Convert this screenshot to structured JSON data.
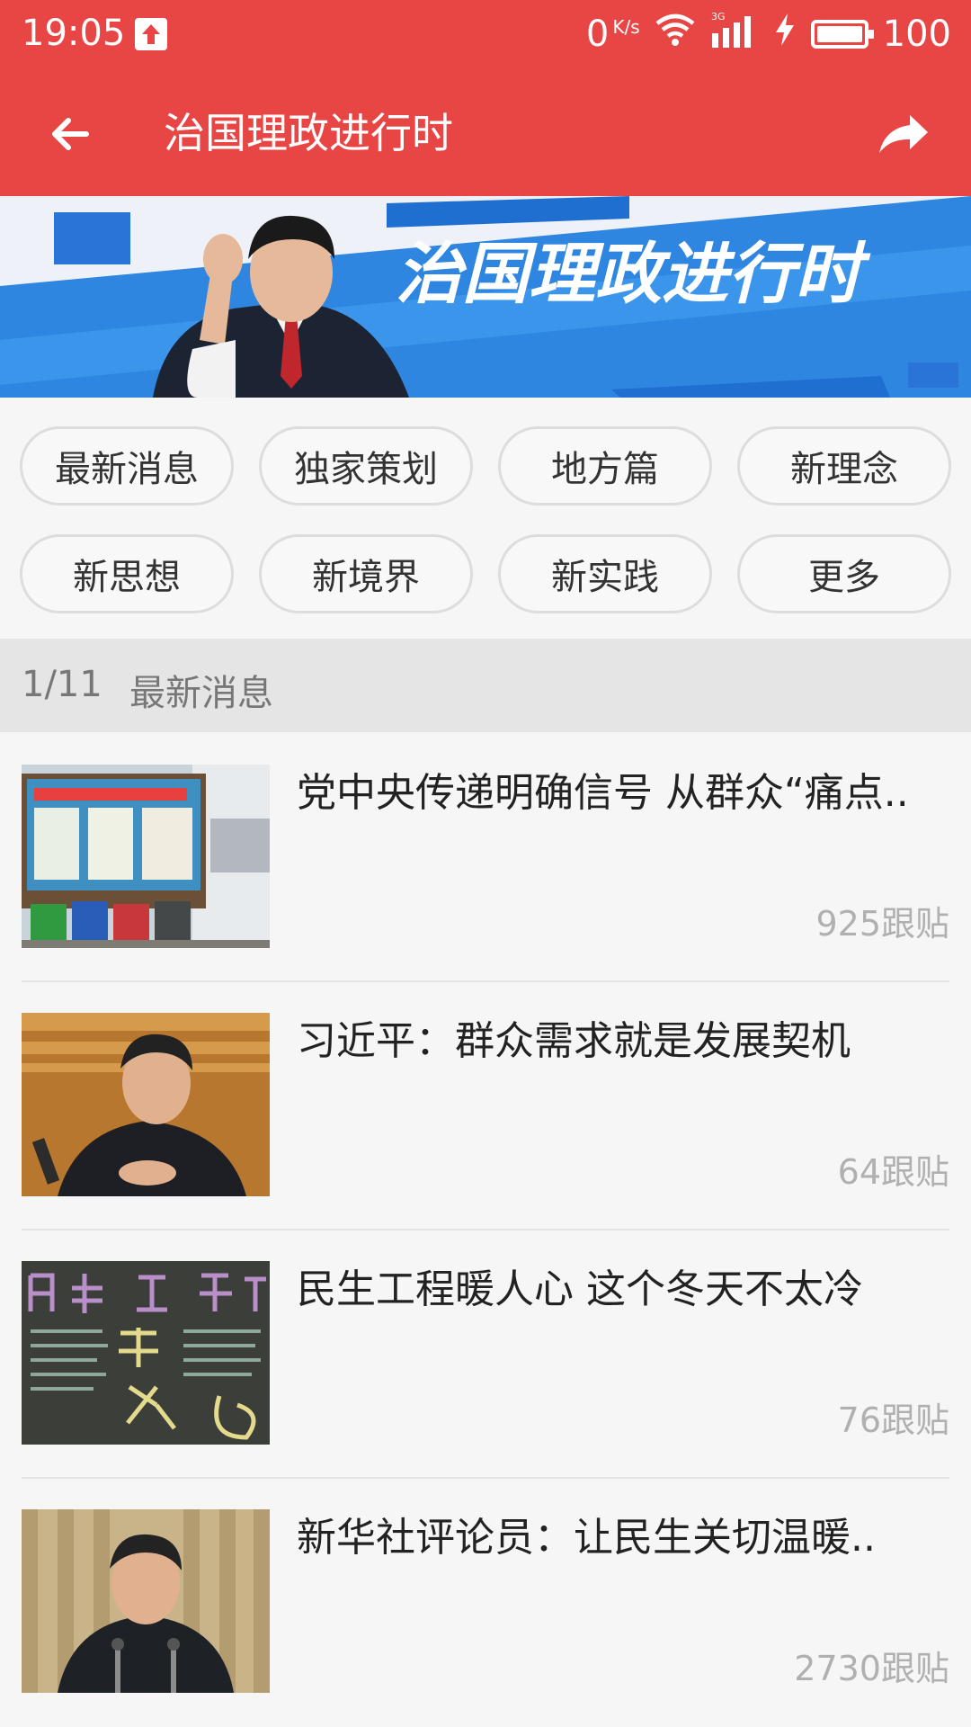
{
  "status_bar": {
    "time": "19:05",
    "net_speed": "0",
    "net_unit": "K/s",
    "network_type": "3G",
    "battery": "100"
  },
  "nav": {
    "title": "治国理政进行时"
  },
  "banner": {
    "title": "治国理政进行时"
  },
  "categories": [
    {
      "label": "最新消息"
    },
    {
      "label": "独家策划"
    },
    {
      "label": "地方篇"
    },
    {
      "label": "新理念"
    },
    {
      "label": "新思想"
    },
    {
      "label": "新境界"
    },
    {
      "label": "新实践"
    },
    {
      "label": "更多"
    }
  ],
  "section": {
    "count": "1/11",
    "name": "最新消息"
  },
  "news": [
    {
      "headline": "党中央传递明确信号 从群众“痛点..",
      "comments": "925跟贴"
    },
    {
      "headline": "习近平：群众需求就是发展契机",
      "comments": "64跟贴"
    },
    {
      "headline": "民生工程暖人心 这个冬天不太冷",
      "comments": "76跟贴"
    },
    {
      "headline": "新华社评论员：让民生关切温暖..",
      "comments": "2730跟贴"
    }
  ],
  "colors": {
    "header": "#e84545",
    "banner_blue": "#2f86e0"
  }
}
